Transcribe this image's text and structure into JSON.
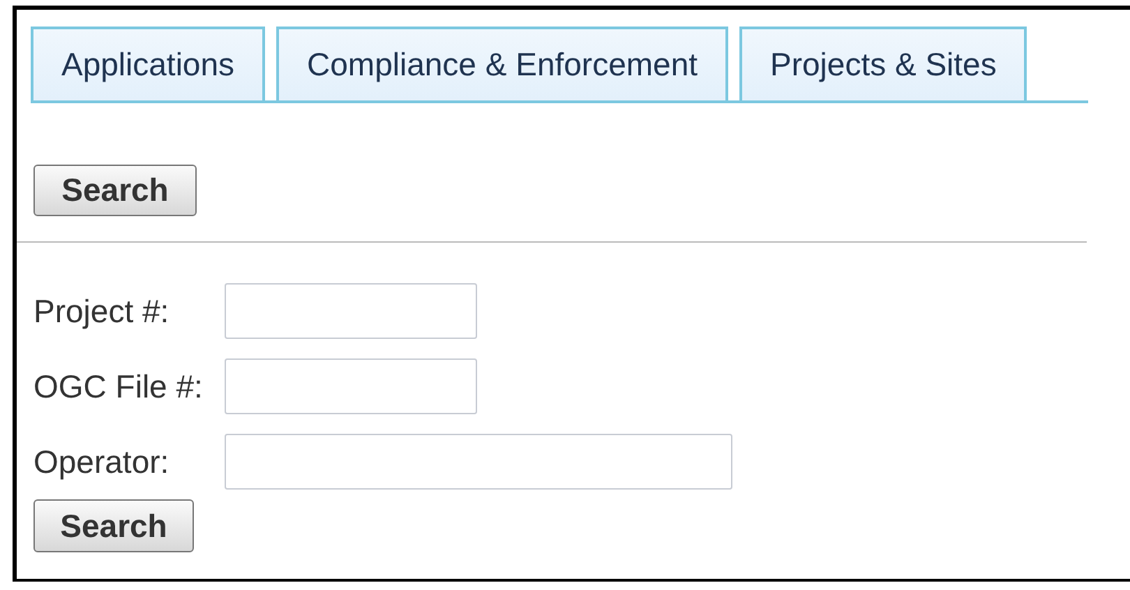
{
  "tabs": [
    {
      "label": "Applications"
    },
    {
      "label": "Compliance & Enforcement"
    },
    {
      "label": "Projects & Sites"
    }
  ],
  "top_button": "Search",
  "fields": [
    {
      "label": "Project #:",
      "kind": "short"
    },
    {
      "label": "OGC File #:",
      "kind": "short"
    },
    {
      "label": "Operator:",
      "kind": "long"
    }
  ],
  "bottom_button": "Search"
}
